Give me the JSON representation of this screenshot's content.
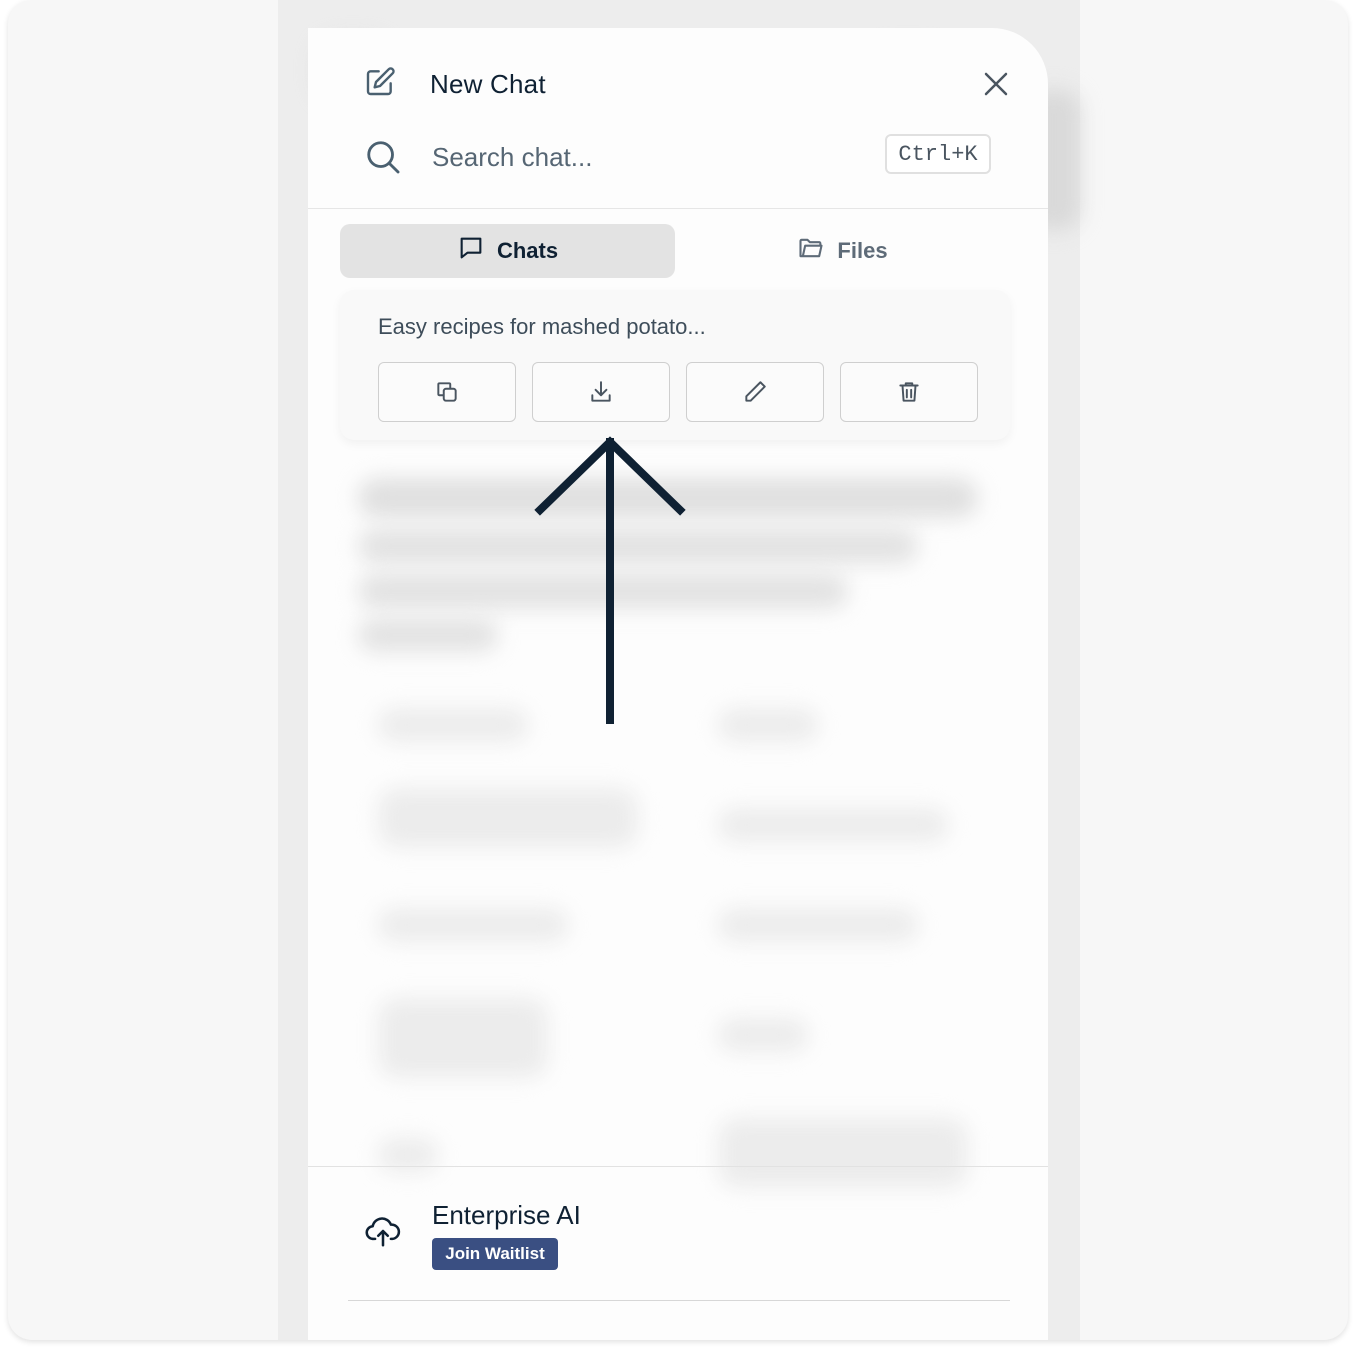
{
  "header": {
    "new_chat_label": "New Chat",
    "search_placeholder": "Search chat...",
    "shortcut": "Ctrl+K"
  },
  "tabs": [
    {
      "label": "Chats",
      "icon": "chat-bubble-icon",
      "active": true
    },
    {
      "label": "Files",
      "icon": "folder-icon",
      "active": false
    }
  ],
  "chat_item": {
    "title": "Easy recipes for mashed potato...",
    "actions": [
      "copy-icon",
      "download-icon",
      "edit-icon",
      "trash-icon"
    ]
  },
  "footer": {
    "title": "Enterprise AI",
    "button_label": "Join Waitlist",
    "icon": "cloud-upload-icon"
  },
  "colors": {
    "accent": "#3a4f82",
    "text": "#0f2133",
    "arrow": "#0f2133"
  }
}
